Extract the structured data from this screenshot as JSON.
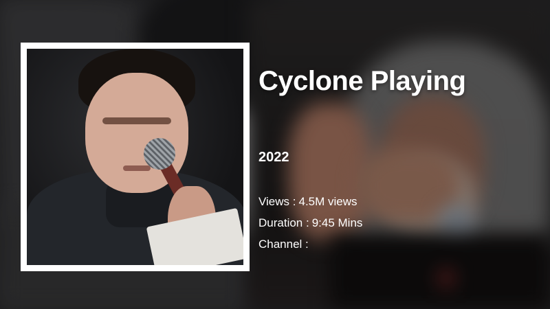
{
  "video": {
    "title": "Cyclone Playing",
    "year": "2022",
    "views_label": "Views :",
    "views_value": "4.5M views",
    "duration_label": "Duration :",
    "duration_value": "9:45 Mins",
    "channel_label": "Channel :",
    "channel_value": ""
  },
  "colors": {
    "text": "#ffffff",
    "frame": "#ffffff"
  }
}
